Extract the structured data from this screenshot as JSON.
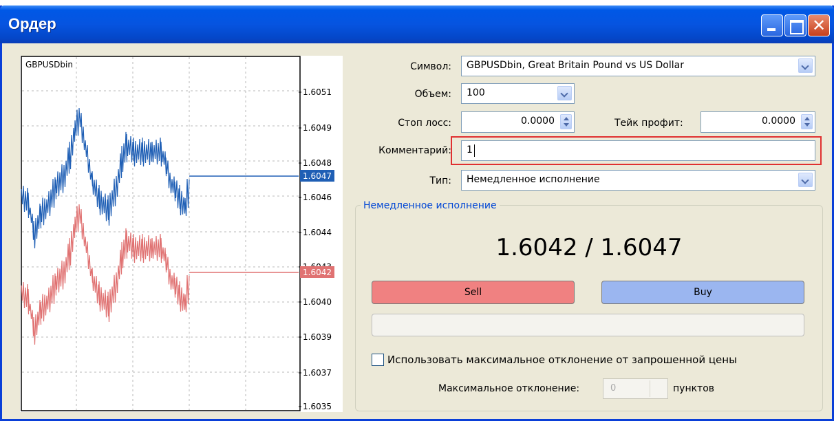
{
  "window": {
    "title": "Ордер"
  },
  "chart": {
    "symbol": "GBPUSDbin",
    "axis_labels": [
      "1.6051",
      "1.6049",
      "1.6048",
      "1.6046",
      "1.6044",
      "1.6043",
      "1.6040",
      "1.6039",
      "1.6037",
      "1.6035"
    ],
    "ask_tag": "1.6047",
    "bid_tag": "1.6042"
  },
  "chart_data": {
    "type": "line",
    "series": [
      {
        "color": "#1f5fb5",
        "last_value": 1.6047
      },
      {
        "color": "#e07272",
        "last_value": 1.6042
      }
    ],
    "yticks": [
      1.6051,
      1.6049,
      1.6048,
      1.6046,
      1.6044,
      1.6043,
      1.604,
      1.6039,
      1.6037,
      1.6035
    ],
    "grid": true
  },
  "form": {
    "symbol_label": "Символ:",
    "symbol_value": "GBPUSDbin, Great Britain Pound vs US Dollar",
    "volume_label": "Объем:",
    "volume_value": "100",
    "stoploss_label": "Стоп лосс:",
    "stoploss_value": "0.0000",
    "takeprofit_label": "Тейк профит:",
    "takeprofit_value": "0.0000",
    "comment_label": "Комментарий:",
    "comment_value": "1",
    "type_label": "Тип:",
    "type_value": "Немедленное исполнение"
  },
  "execution": {
    "group_title": "Немедленное исполнение",
    "prices": "1.6042 / 1.6047",
    "sell_label": "Sell",
    "buy_label": "Buy",
    "max_dev_checkbox_label": "Использовать максимальное отклонение от запрошенной цены",
    "max_dev_label": "Максимальное отклонение:",
    "max_dev_value": "0",
    "points_label": "пунктов"
  },
  "colors": {
    "title_bar": "#0058e6",
    "sell": "#f08181",
    "buy": "#9bb6f0",
    "highlight": "#e03030"
  }
}
